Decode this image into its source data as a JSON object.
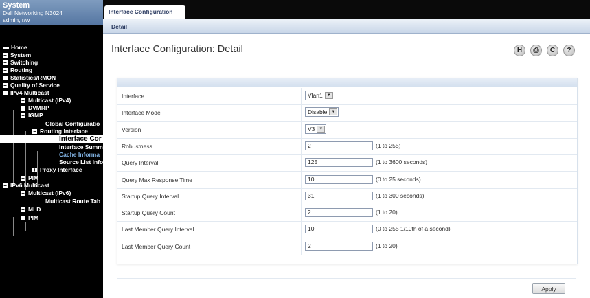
{
  "system": {
    "title": "System",
    "model": "Dell Networking N3024",
    "user": "admin, r/w"
  },
  "nav": {
    "home": "Home",
    "system": "System",
    "switching": "Switching",
    "routing": "Routing",
    "statistics": "Statistics/RMON",
    "qos": "Quality of Service",
    "ipv4_multicast": "IPv4 Multicast",
    "multicast_ipv4": "Multicast (IPv4)",
    "dvmrp": "DVMRP",
    "igmp": "IGMP",
    "global_config": "Global Configuratio",
    "routing_interface": "Routing Interface",
    "interface_config": "Interface Cor",
    "interface_summary": "Interface Summ",
    "cache_information": "Cache Informa",
    "source_list": "Source List Info",
    "proxy_interface": "Proxy Interface",
    "pim_v4": "PIM",
    "ipv6_multicast": "IPv6 Multicast",
    "multicast_ipv6": "Multicast (IPv6)",
    "multicast_route_table": "Multicast Route Tab",
    "mld": "MLD",
    "pim_v6": "PIM"
  },
  "tabs": {
    "main_tab": "Interface Configuration",
    "sub_tab": "Detail"
  },
  "page": {
    "title": "Interface Configuration: Detail"
  },
  "toolbar": {
    "help": "H",
    "print": "⎙",
    "refresh": "C",
    "question": "?"
  },
  "form": {
    "fields": [
      {
        "label": "Interface",
        "value": "Vlan1",
        "type": "select",
        "range": ""
      },
      {
        "label": "Interface Mode",
        "value": "Disable",
        "type": "select",
        "range": ""
      },
      {
        "label": "Version",
        "value": "V3",
        "type": "select",
        "range": ""
      },
      {
        "label": "Robustness",
        "value": "2",
        "type": "input",
        "range": "(1 to 255)"
      },
      {
        "label": "Query Interval",
        "value": "125",
        "type": "input",
        "range": "(1 to 3600 seconds)"
      },
      {
        "label": "Query Max Response Time",
        "value": "10",
        "type": "input",
        "range": "(0 to 25 seconds)"
      },
      {
        "label": "Startup Query Interval",
        "value": "31",
        "type": "input",
        "range": "(1 to 300 seconds)"
      },
      {
        "label": "Startup Query Count",
        "value": "2",
        "type": "input",
        "range": "(1 to 20)"
      },
      {
        "label": "Last Member Query Interval",
        "value": "10",
        "type": "input",
        "range": "(0 to 255 1/10th of a second)"
      },
      {
        "label": "Last Member Query Count",
        "value": "2",
        "type": "input",
        "range": "(1 to 20)"
      }
    ]
  },
  "actions": {
    "apply": "Apply"
  }
}
